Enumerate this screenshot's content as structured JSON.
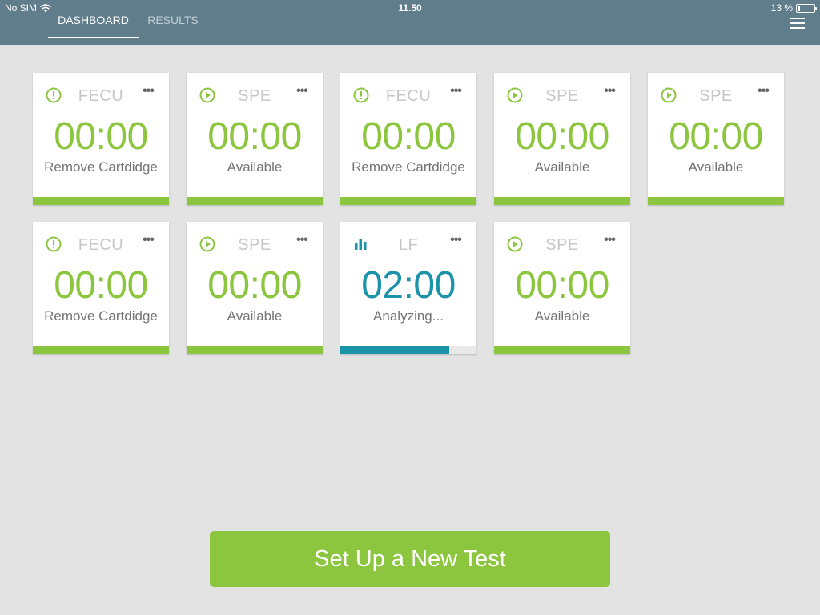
{
  "status_bar": {
    "carrier": "No SIM",
    "time": "11.50",
    "battery": "13 %"
  },
  "tabs": [
    {
      "label": "DASHBOARD",
      "active": true
    },
    {
      "label": "RESULTS",
      "active": false
    }
  ],
  "colors": {
    "header": "#5f7d8b",
    "accent_green": "#8cc63f",
    "accent_teal": "#1b93a8",
    "background": "#e3e3e3"
  },
  "cards": [
    {
      "icon": "alert-icon",
      "type": "FECU",
      "time": "00:00",
      "status": "Remove Cartdidge",
      "progress": 1.0
    },
    {
      "icon": "play-icon",
      "type": "SPE",
      "time": "00:00",
      "status": "Available",
      "progress": 1.0
    },
    {
      "icon": "alert-icon",
      "type": "FECU",
      "time": "00:00",
      "status": "Remove Cartdidge",
      "progress": 1.0
    },
    {
      "icon": "play-icon",
      "type": "SPE",
      "time": "00:00",
      "status": "Available",
      "progress": 1.0
    },
    {
      "icon": "play-icon",
      "type": "SPE",
      "time": "00:00",
      "status": "Available",
      "progress": 1.0
    },
    {
      "icon": "alert-icon",
      "type": "FECU",
      "time": "00:00",
      "status": "Remove Cartdidge",
      "progress": 1.0
    },
    {
      "icon": "play-icon",
      "type": "SPE",
      "time": "00:00",
      "status": "Available",
      "progress": 1.0
    },
    {
      "icon": "bar-chart-icon",
      "type": "LF",
      "time": "02:00",
      "status": "Analyzing...",
      "progress": 0.8
    },
    {
      "icon": "play-icon",
      "type": "SPE",
      "time": "00:00",
      "status": "Available",
      "progress": 1.0
    }
  ],
  "new_test_button": "Set Up a New Test"
}
